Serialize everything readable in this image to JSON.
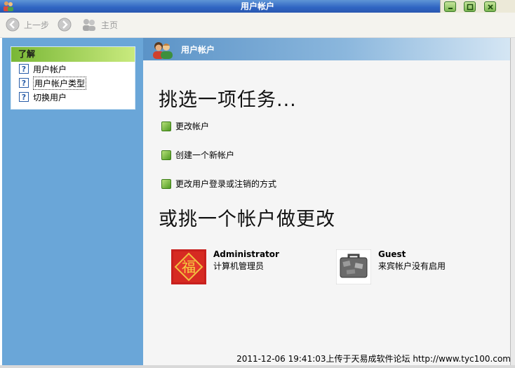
{
  "window": {
    "title": "用户帐户",
    "title_icon": "users-icon",
    "controls": [
      "minimize-icon",
      "maximize-icon",
      "close-icon"
    ]
  },
  "toolbar": {
    "back_label": "上一步",
    "home_label": "主页"
  },
  "learn": {
    "header": "了解",
    "items": [
      {
        "label": "用户帐户",
        "icon": "help-icon"
      },
      {
        "label": "用户帐户类型",
        "icon": "help-icon"
      },
      {
        "label": "切换用户",
        "icon": "help-icon"
      }
    ]
  },
  "main": {
    "header_title": "用户帐户",
    "task_heading": "挑选一项任务...",
    "tasks": [
      {
        "label": "更改帐户"
      },
      {
        "label": "创建一个新帐户"
      },
      {
        "label": "更改用户登录或注销的方式"
      }
    ],
    "accounts_heading": "或挑一个帐户做更改",
    "accounts": [
      {
        "name": "Administrator",
        "description": "计算机管理员",
        "picture": "fu-character-picture"
      },
      {
        "name": "Guest",
        "description": "来宾帐户没有启用",
        "picture": "suitcase-picture"
      }
    ]
  },
  "watermark": "2011-12-06 19:41:03上传于天易成软件论坛 http://www.tyc100.com",
  "colors": {
    "titlebar": "#2f64c2",
    "left_pane": "#6aa6d8",
    "learn_header": "#79b736",
    "task_bullet": "#4f9a20"
  }
}
